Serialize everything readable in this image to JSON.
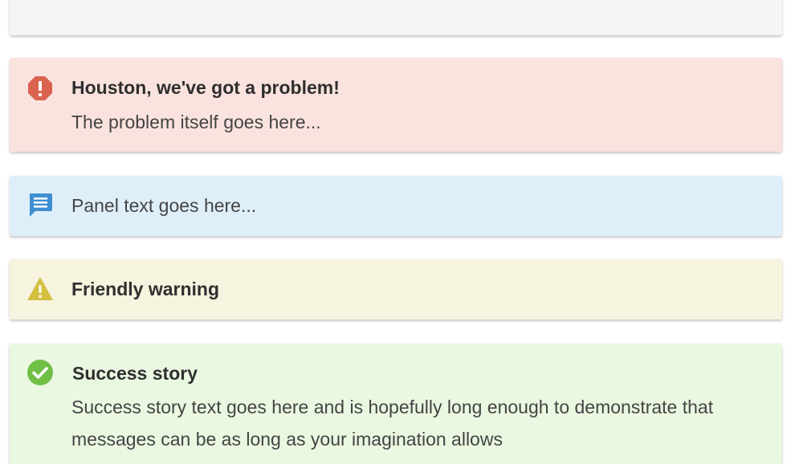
{
  "panels": {
    "error": {
      "icon": "exclamation-octagon-icon",
      "title": "Houston, we've got a problem!",
      "text": "The problem itself goes here..."
    },
    "info": {
      "icon": "chat-message-icon",
      "text": "Panel text goes here..."
    },
    "warning": {
      "icon": "warning-triangle-icon",
      "title": "Friendly warning"
    },
    "success": {
      "icon": "check-circle-icon",
      "title": "Success story",
      "text": "Success story text goes here and is hopefully long enough to demonstrate that messages can be as long as your imagination allows"
    }
  },
  "colors": {
    "neutral_bg": "#f5f5f5",
    "error_bg": "#fae3df",
    "error_icon": "#d9634f",
    "info_bg": "#dfeff9",
    "info_icon": "#3f8fd1",
    "warning_bg": "#f6f3df",
    "warning_icon": "#d4bf3f",
    "success_bg": "#eaf7e1",
    "success_icon": "#6fbf45"
  }
}
